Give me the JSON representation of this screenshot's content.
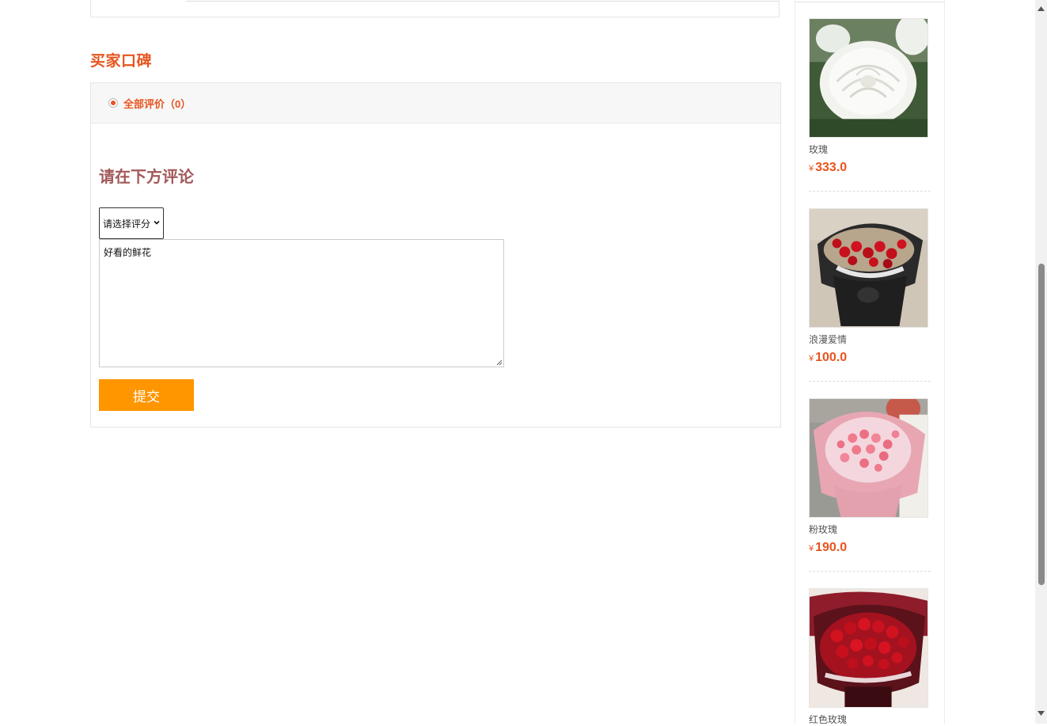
{
  "reviews": {
    "section_title": "买家口碑",
    "filter_all": "全部评价（0）",
    "comment_heading": "请在下方评论",
    "rating_select": {
      "value": "请选择评分"
    },
    "comment_text": "好看的鲜花",
    "submit_label": "提交"
  },
  "sidebar": {
    "products": [
      {
        "name": "玫瑰",
        "currency": "¥",
        "price": "333.0"
      },
      {
        "name": "浪漫爱情",
        "currency": "¥",
        "price": "100.0"
      },
      {
        "name": "粉玫瑰",
        "currency": "¥",
        "price": "190.0"
      },
      {
        "name": "红色玫瑰",
        "currency": "¥",
        "price": ""
      }
    ]
  },
  "colors": {
    "accent": "#e8541e",
    "heading": "#a2595a",
    "button": "#ff9600"
  }
}
